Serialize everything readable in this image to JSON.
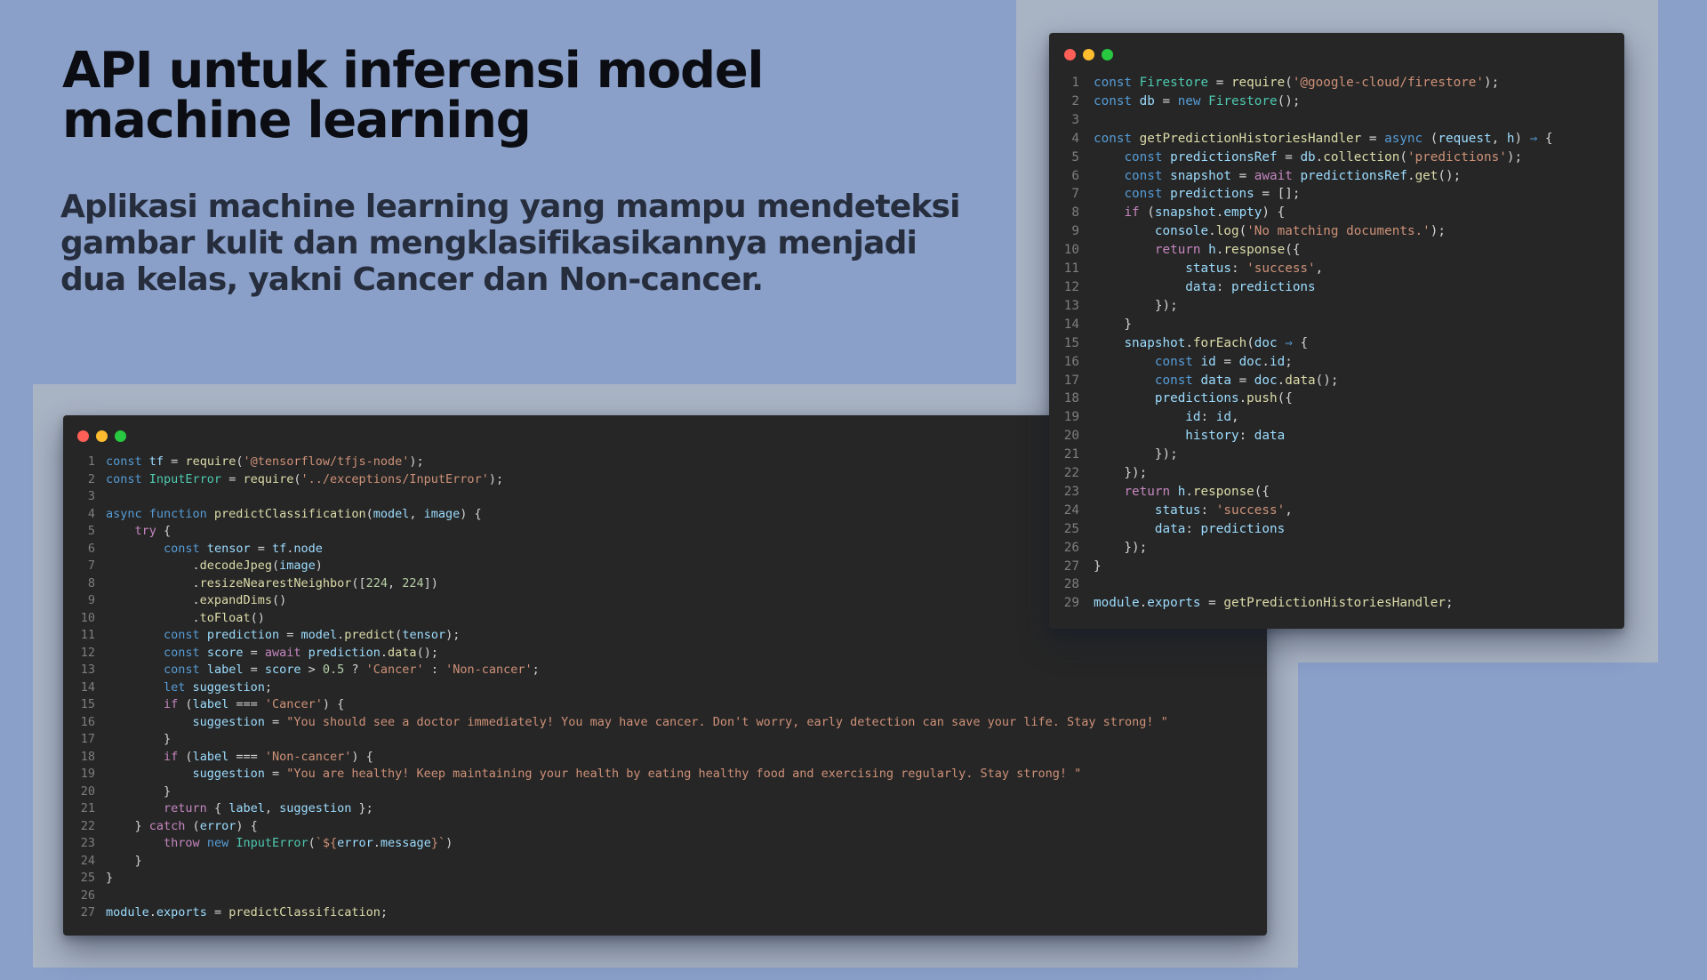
{
  "heading": {
    "title": "API  untuk inferensi model machine learning",
    "subtitle": "Aplikasi machine learning yang mampu mendeteksi gambar kulit dan mengklasifikasikannya menjadi dua kelas, yakni Cancer dan Non-cancer."
  },
  "colors": {
    "background": "#8aa0c9",
    "backdrop": "#a8b3c4",
    "editor_bg": "#262626",
    "dot_red": "#fe5f57",
    "dot_yellow": "#febc2e",
    "dot_green": "#28c840"
  },
  "code_windows": [
    {
      "name": "predict-classification",
      "lines": [
        [
          [
            "kw",
            "const "
          ],
          [
            "var",
            "tf"
          ],
          [
            "op",
            " = "
          ],
          [
            "fn",
            "require"
          ],
          [
            "pl",
            "("
          ],
          [
            "str",
            "'@tensorflow/tfjs-node'"
          ],
          [
            "pl",
            ");"
          ]
        ],
        [
          [
            "kw",
            "const "
          ],
          [
            "cls",
            "InputError"
          ],
          [
            "op",
            " = "
          ],
          [
            "fn",
            "require"
          ],
          [
            "pl",
            "("
          ],
          [
            "str",
            "'../exceptions/InputError'"
          ],
          [
            "pl",
            ");"
          ]
        ],
        [],
        [
          [
            "kw",
            "async function "
          ],
          [
            "fn",
            "predictClassification"
          ],
          [
            "pl",
            "("
          ],
          [
            "var",
            "model"
          ],
          [
            "pl",
            ", "
          ],
          [
            "var",
            "image"
          ],
          [
            "pl",
            ") {"
          ]
        ],
        [
          [
            "pl",
            "    "
          ],
          [
            "ctl",
            "try"
          ],
          [
            "pl",
            " {"
          ]
        ],
        [
          [
            "pl",
            "        "
          ],
          [
            "kw",
            "const "
          ],
          [
            "var",
            "tensor"
          ],
          [
            "op",
            " = "
          ],
          [
            "var",
            "tf"
          ],
          [
            "pl",
            "."
          ],
          [
            "var",
            "node"
          ]
        ],
        [
          [
            "pl",
            "            ."
          ],
          [
            "fn",
            "decodeJpeg"
          ],
          [
            "pl",
            "("
          ],
          [
            "var",
            "image"
          ],
          [
            "pl",
            ")"
          ]
        ],
        [
          [
            "pl",
            "            ."
          ],
          [
            "fn",
            "resizeNearestNeighbor"
          ],
          [
            "pl",
            "(["
          ],
          [
            "num",
            "224"
          ],
          [
            "pl",
            ", "
          ],
          [
            "num",
            "224"
          ],
          [
            "pl",
            "])"
          ]
        ],
        [
          [
            "pl",
            "            ."
          ],
          [
            "fn",
            "expandDims"
          ],
          [
            "pl",
            "()"
          ]
        ],
        [
          [
            "pl",
            "            ."
          ],
          [
            "fn",
            "toFloat"
          ],
          [
            "pl",
            "()"
          ]
        ],
        [
          [
            "pl",
            "        "
          ],
          [
            "kw",
            "const "
          ],
          [
            "var",
            "prediction"
          ],
          [
            "op",
            " = "
          ],
          [
            "var",
            "model"
          ],
          [
            "pl",
            "."
          ],
          [
            "fn",
            "predict"
          ],
          [
            "pl",
            "("
          ],
          [
            "var",
            "tensor"
          ],
          [
            "pl",
            ");"
          ]
        ],
        [
          [
            "pl",
            "        "
          ],
          [
            "kw",
            "const "
          ],
          [
            "var",
            "score"
          ],
          [
            "op",
            " = "
          ],
          [
            "ctl",
            "await "
          ],
          [
            "var",
            "prediction"
          ],
          [
            "pl",
            "."
          ],
          [
            "fn",
            "data"
          ],
          [
            "pl",
            "();"
          ]
        ],
        [
          [
            "pl",
            "        "
          ],
          [
            "kw",
            "const "
          ],
          [
            "var",
            "label"
          ],
          [
            "op",
            " = "
          ],
          [
            "var",
            "score"
          ],
          [
            "op",
            " > "
          ],
          [
            "num",
            "0.5"
          ],
          [
            "op",
            " ? "
          ],
          [
            "str",
            "'Cancer'"
          ],
          [
            "op",
            " : "
          ],
          [
            "str",
            "'Non-cancer'"
          ],
          [
            "pl",
            ";"
          ]
        ],
        [
          [
            "pl",
            "        "
          ],
          [
            "kw",
            "let "
          ],
          [
            "var",
            "suggestion"
          ],
          [
            "pl",
            ";"
          ]
        ],
        [
          [
            "pl",
            "        "
          ],
          [
            "ctl",
            "if"
          ],
          [
            "pl",
            " ("
          ],
          [
            "var",
            "label"
          ],
          [
            "op",
            " === "
          ],
          [
            "str",
            "'Cancer'"
          ],
          [
            "pl",
            ") {"
          ]
        ],
        [
          [
            "pl",
            "            "
          ],
          [
            "var",
            "suggestion"
          ],
          [
            "op",
            " = "
          ],
          [
            "str",
            "\"You should see a doctor immediately! You may have cancer. Don't worry, early detection can save your life. Stay strong! \""
          ]
        ],
        [
          [
            "pl",
            "        }"
          ]
        ],
        [
          [
            "pl",
            "        "
          ],
          [
            "ctl",
            "if"
          ],
          [
            "pl",
            " ("
          ],
          [
            "var",
            "label"
          ],
          [
            "op",
            " === "
          ],
          [
            "str",
            "'Non-cancer'"
          ],
          [
            "pl",
            ") {"
          ]
        ],
        [
          [
            "pl",
            "            "
          ],
          [
            "var",
            "suggestion"
          ],
          [
            "op",
            " = "
          ],
          [
            "str",
            "\"You are healthy! Keep maintaining your health by eating healthy food and exercising regularly. Stay strong! \""
          ]
        ],
        [
          [
            "pl",
            "        }"
          ]
        ],
        [
          [
            "pl",
            "        "
          ],
          [
            "ctl",
            "return"
          ],
          [
            "pl",
            " { "
          ],
          [
            "var",
            "label"
          ],
          [
            "pl",
            ", "
          ],
          [
            "var",
            "suggestion"
          ],
          [
            "pl",
            " };"
          ]
        ],
        [
          [
            "pl",
            "    } "
          ],
          [
            "ctl",
            "catch"
          ],
          [
            "pl",
            " ("
          ],
          [
            "var",
            "error"
          ],
          [
            "pl",
            ") {"
          ]
        ],
        [
          [
            "pl",
            "        "
          ],
          [
            "ctl",
            "throw "
          ],
          [
            "kw",
            "new "
          ],
          [
            "cls",
            "InputError"
          ],
          [
            "pl",
            "("
          ],
          [
            "str",
            "`${"
          ],
          [
            "var",
            "error"
          ],
          [
            "pl",
            "."
          ],
          [
            "var",
            "message"
          ],
          [
            "str",
            "}`"
          ],
          [
            "pl",
            ")"
          ]
        ],
        [
          [
            "pl",
            "    }"
          ]
        ],
        [
          [
            "pl",
            "}"
          ]
        ],
        [],
        [
          [
            "var",
            "module"
          ],
          [
            "pl",
            "."
          ],
          [
            "var",
            "exports"
          ],
          [
            "op",
            " = "
          ],
          [
            "fn",
            "predictClassification"
          ],
          [
            "pl",
            ";"
          ]
        ]
      ]
    },
    {
      "name": "prediction-histories-handler",
      "lines": [
        [
          [
            "kw",
            "const "
          ],
          [
            "cls",
            "Firestore"
          ],
          [
            "op",
            " = "
          ],
          [
            "fn",
            "require"
          ],
          [
            "pl",
            "("
          ],
          [
            "str",
            "'@google-cloud/firestore'"
          ],
          [
            "pl",
            ");"
          ]
        ],
        [
          [
            "kw",
            "const "
          ],
          [
            "var",
            "db"
          ],
          [
            "op",
            " = "
          ],
          [
            "kw",
            "new "
          ],
          [
            "cls",
            "Firestore"
          ],
          [
            "pl",
            "();"
          ]
        ],
        [],
        [
          [
            "kw",
            "const "
          ],
          [
            "fn",
            "getPredictionHistoriesHandler"
          ],
          [
            "op",
            " = "
          ],
          [
            "kw",
            "async "
          ],
          [
            "pl",
            "("
          ],
          [
            "var",
            "request"
          ],
          [
            "pl",
            ", "
          ],
          [
            "var",
            "h"
          ],
          [
            "pl",
            ") "
          ],
          [
            "kw",
            "⇒"
          ],
          [
            "pl",
            " {"
          ]
        ],
        [
          [
            "pl",
            "    "
          ],
          [
            "kw",
            "const "
          ],
          [
            "var",
            "predictionsRef"
          ],
          [
            "op",
            " = "
          ],
          [
            "var",
            "db"
          ],
          [
            "pl",
            "."
          ],
          [
            "fn",
            "collection"
          ],
          [
            "pl",
            "("
          ],
          [
            "str",
            "'predictions'"
          ],
          [
            "pl",
            ");"
          ]
        ],
        [
          [
            "pl",
            "    "
          ],
          [
            "kw",
            "const "
          ],
          [
            "var",
            "snapshot"
          ],
          [
            "op",
            " = "
          ],
          [
            "ctl",
            "await "
          ],
          [
            "var",
            "predictionsRef"
          ],
          [
            "pl",
            "."
          ],
          [
            "fn",
            "get"
          ],
          [
            "pl",
            "();"
          ]
        ],
        [
          [
            "pl",
            "    "
          ],
          [
            "kw",
            "const "
          ],
          [
            "var",
            "predictions"
          ],
          [
            "op",
            " = "
          ],
          [
            "pl",
            "[];"
          ]
        ],
        [
          [
            "pl",
            "    "
          ],
          [
            "ctl",
            "if"
          ],
          [
            "pl",
            " ("
          ],
          [
            "var",
            "snapshot"
          ],
          [
            "pl",
            "."
          ],
          [
            "var",
            "empty"
          ],
          [
            "pl",
            ") {"
          ]
        ],
        [
          [
            "pl",
            "        "
          ],
          [
            "var",
            "console"
          ],
          [
            "pl",
            "."
          ],
          [
            "fn",
            "log"
          ],
          [
            "pl",
            "("
          ],
          [
            "str",
            "'No matching documents.'"
          ],
          [
            "pl",
            ");"
          ]
        ],
        [
          [
            "pl",
            "        "
          ],
          [
            "ctl",
            "return "
          ],
          [
            "var",
            "h"
          ],
          [
            "pl",
            "."
          ],
          [
            "fn",
            "response"
          ],
          [
            "pl",
            "({"
          ]
        ],
        [
          [
            "pl",
            "            "
          ],
          [
            "var",
            "status"
          ],
          [
            "pl",
            ": "
          ],
          [
            "str",
            "'success'"
          ],
          [
            "pl",
            ","
          ]
        ],
        [
          [
            "pl",
            "            "
          ],
          [
            "var",
            "data"
          ],
          [
            "pl",
            ": "
          ],
          [
            "var",
            "predictions"
          ]
        ],
        [
          [
            "pl",
            "        });"
          ]
        ],
        [
          [
            "pl",
            "    }"
          ]
        ],
        [
          [
            "pl",
            "    "
          ],
          [
            "var",
            "snapshot"
          ],
          [
            "pl",
            "."
          ],
          [
            "fn",
            "forEach"
          ],
          [
            "pl",
            "("
          ],
          [
            "var",
            "doc"
          ],
          [
            "pl",
            " "
          ],
          [
            "kw",
            "⇒"
          ],
          [
            "pl",
            " {"
          ]
        ],
        [
          [
            "pl",
            "        "
          ],
          [
            "kw",
            "const "
          ],
          [
            "var",
            "id"
          ],
          [
            "op",
            " = "
          ],
          [
            "var",
            "doc"
          ],
          [
            "pl",
            "."
          ],
          [
            "var",
            "id"
          ],
          [
            "pl",
            ";"
          ]
        ],
        [
          [
            "pl",
            "        "
          ],
          [
            "kw",
            "const "
          ],
          [
            "var",
            "data"
          ],
          [
            "op",
            " = "
          ],
          [
            "var",
            "doc"
          ],
          [
            "pl",
            "."
          ],
          [
            "fn",
            "data"
          ],
          [
            "pl",
            "();"
          ]
        ],
        [
          [
            "pl",
            "        "
          ],
          [
            "var",
            "predictions"
          ],
          [
            "pl",
            "."
          ],
          [
            "fn",
            "push"
          ],
          [
            "pl",
            "({"
          ]
        ],
        [
          [
            "pl",
            "            "
          ],
          [
            "var",
            "id"
          ],
          [
            "pl",
            ": "
          ],
          [
            "var",
            "id"
          ],
          [
            "pl",
            ","
          ]
        ],
        [
          [
            "pl",
            "            "
          ],
          [
            "var",
            "history"
          ],
          [
            "pl",
            ": "
          ],
          [
            "var",
            "data"
          ]
        ],
        [
          [
            "pl",
            "        });"
          ]
        ],
        [
          [
            "pl",
            "    });"
          ]
        ],
        [
          [
            "pl",
            "    "
          ],
          [
            "ctl",
            "return "
          ],
          [
            "var",
            "h"
          ],
          [
            "pl",
            "."
          ],
          [
            "fn",
            "response"
          ],
          [
            "pl",
            "({"
          ]
        ],
        [
          [
            "pl",
            "        "
          ],
          [
            "var",
            "status"
          ],
          [
            "pl",
            ": "
          ],
          [
            "str",
            "'success'"
          ],
          [
            "pl",
            ","
          ]
        ],
        [
          [
            "pl",
            "        "
          ],
          [
            "var",
            "data"
          ],
          [
            "pl",
            ": "
          ],
          [
            "var",
            "predictions"
          ]
        ],
        [
          [
            "pl",
            "    });"
          ]
        ],
        [
          [
            "pl",
            "}"
          ]
        ],
        [],
        [
          [
            "var",
            "module"
          ],
          [
            "pl",
            "."
          ],
          [
            "var",
            "exports"
          ],
          [
            "op",
            " = "
          ],
          [
            "fn",
            "getPredictionHistoriesHandler"
          ],
          [
            "pl",
            ";"
          ]
        ]
      ]
    }
  ]
}
